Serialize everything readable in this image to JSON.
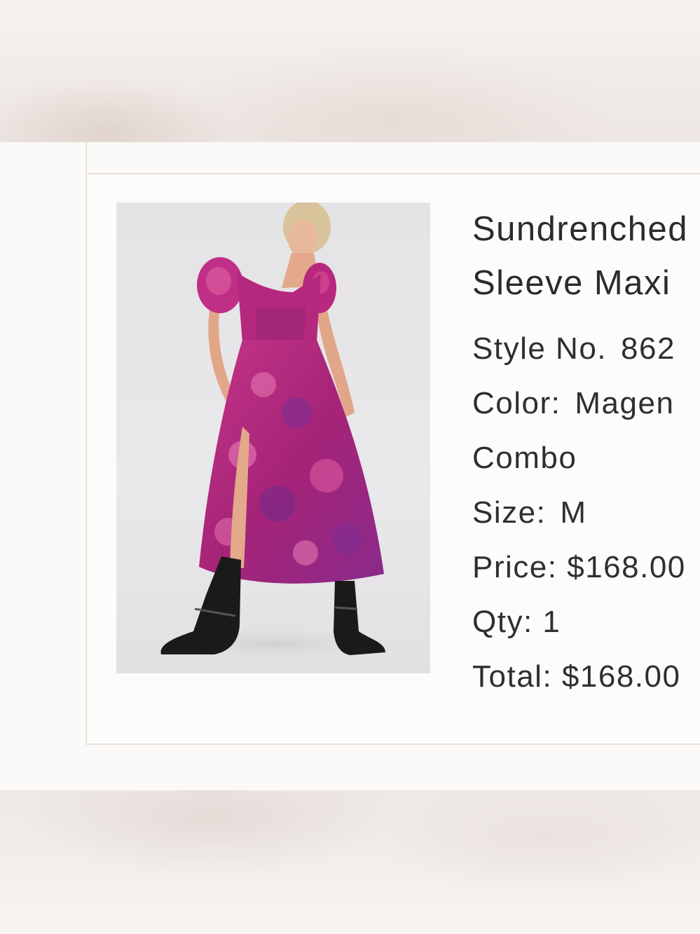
{
  "product": {
    "title_line1": "Sundrenched",
    "title_line2": "Sleeve Maxi",
    "style_label": "Style No.",
    "style_value": "862",
    "color_label": "Color:",
    "color_value": "Magen",
    "color_value_line2": "Combo",
    "size_label": "Size:",
    "size_value": "M",
    "price_label": "Price:",
    "price_value": "$168.00",
    "qty_label": "Qty:",
    "qty_value": "1",
    "total_label": "Total:",
    "total_value": "$168.00"
  },
  "colors": {
    "dress_primary": "#b0267a",
    "dress_secondary": "#d84f96",
    "dress_dark": "#6e2a8c",
    "boots": "#1a1a1a",
    "text": "#2e2e2e"
  }
}
